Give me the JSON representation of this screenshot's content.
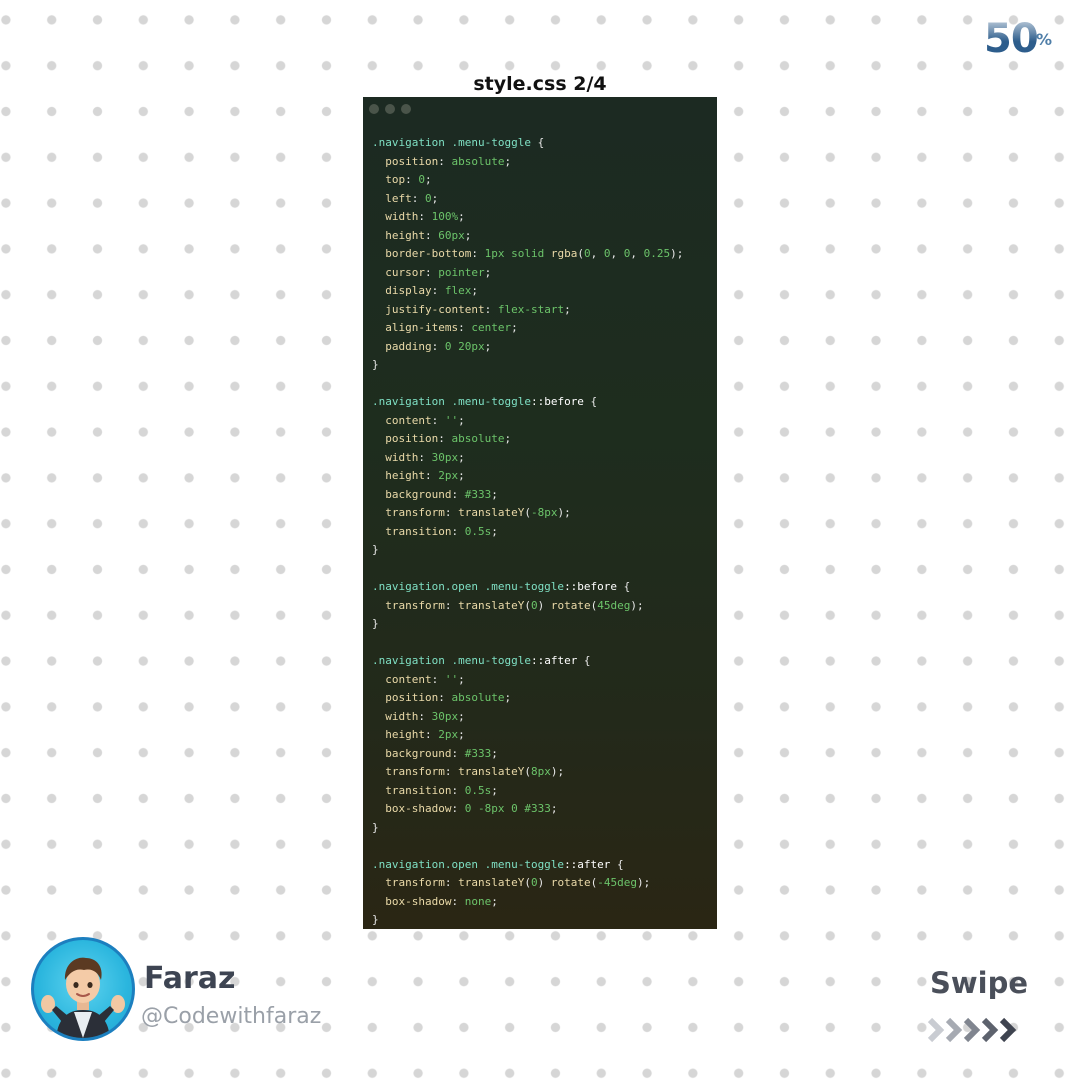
{
  "progress": {
    "value": "50",
    "unit": "%"
  },
  "file_title": "style.css 2/4",
  "code_lines": [
    [
      [
        "sel",
        ".navigation .menu-toggle"
      ],
      [
        "punc",
        " {"
      ]
    ],
    [
      [
        "prop",
        "  position"
      ],
      [
        "punc",
        ": "
      ],
      [
        "val",
        "absolute"
      ],
      [
        "punc",
        ";"
      ]
    ],
    [
      [
        "prop",
        "  top"
      ],
      [
        "punc",
        ": "
      ],
      [
        "val",
        "0"
      ],
      [
        "punc",
        ";"
      ]
    ],
    [
      [
        "prop",
        "  left"
      ],
      [
        "punc",
        ": "
      ],
      [
        "val",
        "0"
      ],
      [
        "punc",
        ";"
      ]
    ],
    [
      [
        "prop",
        "  width"
      ],
      [
        "punc",
        ": "
      ],
      [
        "val",
        "100%"
      ],
      [
        "punc",
        ";"
      ]
    ],
    [
      [
        "prop",
        "  height"
      ],
      [
        "punc",
        ": "
      ],
      [
        "val",
        "60px"
      ],
      [
        "punc",
        ";"
      ]
    ],
    [
      [
        "prop",
        "  border-bottom"
      ],
      [
        "punc",
        ": "
      ],
      [
        "val",
        "1px solid "
      ],
      [
        "fn",
        "rgba"
      ],
      [
        "punc",
        "("
      ],
      [
        "val",
        "0"
      ],
      [
        "punc",
        ", "
      ],
      [
        "val",
        "0"
      ],
      [
        "punc",
        ", "
      ],
      [
        "val",
        "0"
      ],
      [
        "punc",
        ", "
      ],
      [
        "val",
        "0.25"
      ],
      [
        "punc",
        ");"
      ]
    ],
    [
      [
        "prop",
        "  cursor"
      ],
      [
        "punc",
        ": "
      ],
      [
        "val",
        "pointer"
      ],
      [
        "punc",
        ";"
      ]
    ],
    [
      [
        "prop",
        "  display"
      ],
      [
        "punc",
        ": "
      ],
      [
        "val",
        "flex"
      ],
      [
        "punc",
        ";"
      ]
    ],
    [
      [
        "prop",
        "  justify-content"
      ],
      [
        "punc",
        ": "
      ],
      [
        "val",
        "flex-start"
      ],
      [
        "punc",
        ";"
      ]
    ],
    [
      [
        "prop",
        "  align-items"
      ],
      [
        "punc",
        ": "
      ],
      [
        "val",
        "center"
      ],
      [
        "punc",
        ";"
      ]
    ],
    [
      [
        "prop",
        "  padding"
      ],
      [
        "punc",
        ": "
      ],
      [
        "val",
        "0 20px"
      ],
      [
        "punc",
        ";"
      ]
    ],
    [
      [
        "punc",
        "}"
      ]
    ],
    [],
    [
      [
        "sel",
        ".navigation .menu-toggle"
      ],
      [
        "ps",
        "::before"
      ],
      [
        "punc",
        " {"
      ]
    ],
    [
      [
        "prop",
        "  content"
      ],
      [
        "punc",
        ": "
      ],
      [
        "val",
        "''"
      ],
      [
        "punc",
        ";"
      ]
    ],
    [
      [
        "prop",
        "  position"
      ],
      [
        "punc",
        ": "
      ],
      [
        "val",
        "absolute"
      ],
      [
        "punc",
        ";"
      ]
    ],
    [
      [
        "prop",
        "  width"
      ],
      [
        "punc",
        ": "
      ],
      [
        "val",
        "30px"
      ],
      [
        "punc",
        ";"
      ]
    ],
    [
      [
        "prop",
        "  height"
      ],
      [
        "punc",
        ": "
      ],
      [
        "val",
        "2px"
      ],
      [
        "punc",
        ";"
      ]
    ],
    [
      [
        "prop",
        "  background"
      ],
      [
        "punc",
        ": "
      ],
      [
        "val",
        "#333"
      ],
      [
        "punc",
        ";"
      ]
    ],
    [
      [
        "prop",
        "  transform"
      ],
      [
        "punc",
        ": "
      ],
      [
        "fn",
        "translateY"
      ],
      [
        "punc",
        "("
      ],
      [
        "val",
        "-8px"
      ],
      [
        "punc",
        ");"
      ]
    ],
    [
      [
        "prop",
        "  transition"
      ],
      [
        "punc",
        ": "
      ],
      [
        "val",
        "0.5s"
      ],
      [
        "punc",
        ";"
      ]
    ],
    [
      [
        "punc",
        "}"
      ]
    ],
    [],
    [
      [
        "sel",
        ".navigation.open .menu-toggle"
      ],
      [
        "ps",
        "::before"
      ],
      [
        "punc",
        " {"
      ]
    ],
    [
      [
        "prop",
        "  transform"
      ],
      [
        "punc",
        ": "
      ],
      [
        "fn",
        "translateY"
      ],
      [
        "punc",
        "("
      ],
      [
        "val",
        "0"
      ],
      [
        "punc",
        ") "
      ],
      [
        "fn",
        "rotate"
      ],
      [
        "punc",
        "("
      ],
      [
        "val",
        "45deg"
      ],
      [
        "punc",
        ");"
      ]
    ],
    [
      [
        "punc",
        "}"
      ]
    ],
    [],
    [
      [
        "sel",
        ".navigation .menu-toggle"
      ],
      [
        "ps",
        "::after"
      ],
      [
        "punc",
        " {"
      ]
    ],
    [
      [
        "prop",
        "  content"
      ],
      [
        "punc",
        ": "
      ],
      [
        "val",
        "''"
      ],
      [
        "punc",
        ";"
      ]
    ],
    [
      [
        "prop",
        "  position"
      ],
      [
        "punc",
        ": "
      ],
      [
        "val",
        "absolute"
      ],
      [
        "punc",
        ";"
      ]
    ],
    [
      [
        "prop",
        "  width"
      ],
      [
        "punc",
        ": "
      ],
      [
        "val",
        "30px"
      ],
      [
        "punc",
        ";"
      ]
    ],
    [
      [
        "prop",
        "  height"
      ],
      [
        "punc",
        ": "
      ],
      [
        "val",
        "2px"
      ],
      [
        "punc",
        ";"
      ]
    ],
    [
      [
        "prop",
        "  background"
      ],
      [
        "punc",
        ": "
      ],
      [
        "val",
        "#333"
      ],
      [
        "punc",
        ";"
      ]
    ],
    [
      [
        "prop",
        "  transform"
      ],
      [
        "punc",
        ": "
      ],
      [
        "fn",
        "translateY"
      ],
      [
        "punc",
        "("
      ],
      [
        "val",
        "8px"
      ],
      [
        "punc",
        ");"
      ]
    ],
    [
      [
        "prop",
        "  transition"
      ],
      [
        "punc",
        ": "
      ],
      [
        "val",
        "0.5s"
      ],
      [
        "punc",
        ";"
      ]
    ],
    [
      [
        "prop",
        "  box-shadow"
      ],
      [
        "punc",
        ": "
      ],
      [
        "val",
        "0 -8px 0 #333"
      ],
      [
        "punc",
        ";"
      ]
    ],
    [
      [
        "punc",
        "}"
      ]
    ],
    [],
    [
      [
        "sel",
        ".navigation.open .menu-toggle"
      ],
      [
        "ps",
        "::after"
      ],
      [
        "punc",
        " {"
      ]
    ],
    [
      [
        "prop",
        "  transform"
      ],
      [
        "punc",
        ": "
      ],
      [
        "fn",
        "translateY"
      ],
      [
        "punc",
        "("
      ],
      [
        "val",
        "0"
      ],
      [
        "punc",
        ") "
      ],
      [
        "fn",
        "rotate"
      ],
      [
        "punc",
        "("
      ],
      [
        "val",
        "-45deg"
      ],
      [
        "punc",
        ");"
      ]
    ],
    [
      [
        "prop",
        "  box-shadow"
      ],
      [
        "punc",
        ": "
      ],
      [
        "val",
        "none"
      ],
      [
        "punc",
        ";"
      ]
    ],
    [
      [
        "punc",
        "}"
      ]
    ]
  ],
  "author": {
    "name": "Faraz",
    "handle": "@Codewithfaraz",
    "avatar_icon": "memoji-avatar-icon"
  },
  "swipe": {
    "label": "Swipe",
    "icon": "chevrons-right-icon"
  },
  "colors": {
    "accent": "#2d5d8c",
    "code_bg": "#1e2d1e",
    "avatar_bg": "#2bb6de"
  }
}
